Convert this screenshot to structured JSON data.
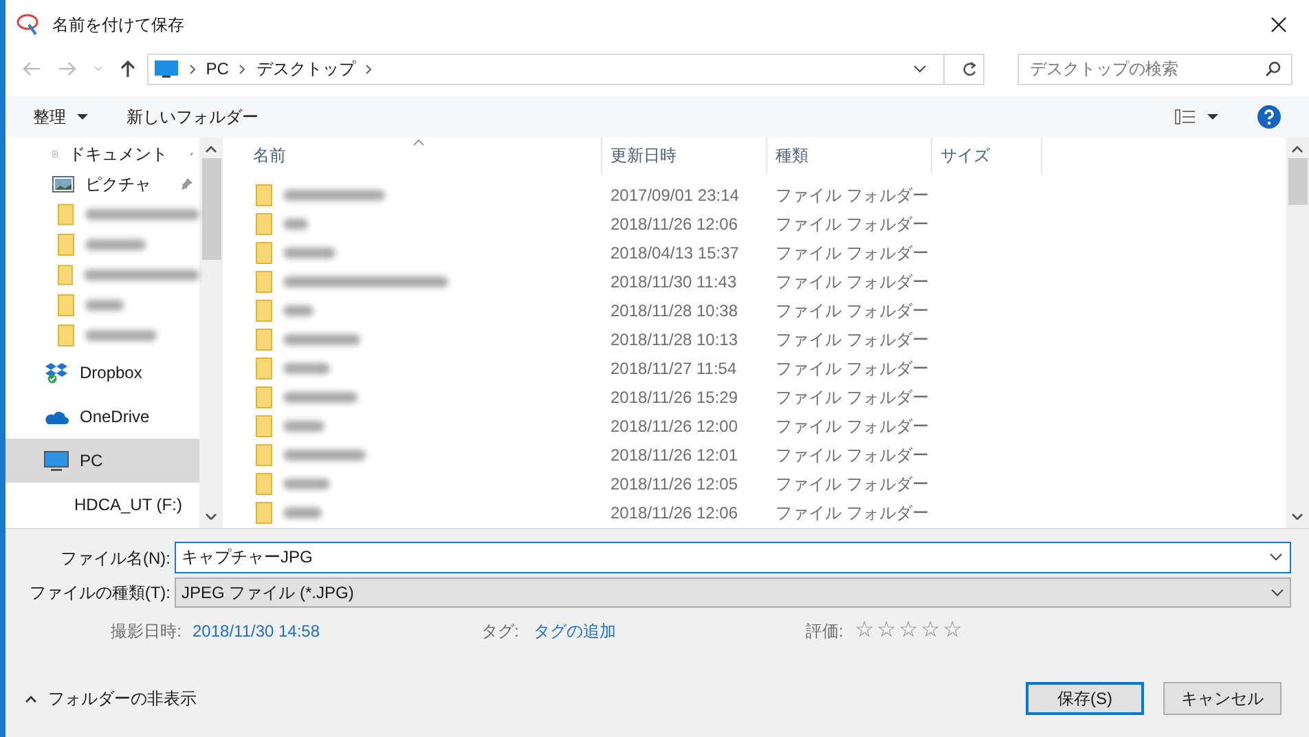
{
  "window": {
    "title": "名前を付けて保存"
  },
  "address": {
    "crumbs": [
      "PC",
      "デスクトップ"
    ]
  },
  "search": {
    "placeholder": "デスクトップの検索"
  },
  "toolbar": {
    "organize": "整理",
    "new_folder": "新しいフォルダー"
  },
  "sidebar": {
    "items": [
      {
        "kind": "document",
        "label": "ドキュメント",
        "pinned": true,
        "selected": false
      },
      {
        "kind": "picture",
        "label": "ピクチャ",
        "pinned": true,
        "selected": false
      },
      {
        "kind": "blurred-folder",
        "selected": false
      },
      {
        "kind": "blurred-folder",
        "selected": false
      },
      {
        "kind": "blurred-folder",
        "selected": false
      },
      {
        "kind": "blurred-folder",
        "selected": false
      },
      {
        "kind": "blurred-folder",
        "selected": false
      },
      {
        "kind": "dropbox",
        "label": "Dropbox",
        "selected": false
      },
      {
        "kind": "onedrive",
        "label": "OneDrive",
        "selected": false
      },
      {
        "kind": "pc",
        "label": "PC",
        "selected": true
      },
      {
        "kind": "drive",
        "label": "HDCA_UT (F:)",
        "selected": false
      }
    ]
  },
  "table": {
    "columns": [
      "名前",
      "更新日時",
      "種類",
      "サイズ"
    ],
    "rows": [
      {
        "modified": "2017/09/01 23:14",
        "type": "ファイル フォルダー"
      },
      {
        "modified": "2018/11/26 12:06",
        "type": "ファイル フォルダー"
      },
      {
        "modified": "2018/04/13 15:37",
        "type": "ファイル フォルダー"
      },
      {
        "modified": "2018/11/30 11:43",
        "type": "ファイル フォルダー"
      },
      {
        "modified": "2018/11/28 10:38",
        "type": "ファイル フォルダー"
      },
      {
        "modified": "2018/11/28 10:13",
        "type": "ファイル フォルダー"
      },
      {
        "modified": "2018/11/27 11:54",
        "type": "ファイル フォルダー"
      },
      {
        "modified": "2018/11/26 15:29",
        "type": "ファイル フォルダー"
      },
      {
        "modified": "2018/11/26 12:00",
        "type": "ファイル フォルダー"
      },
      {
        "modified": "2018/11/26 12:01",
        "type": "ファイル フォルダー"
      },
      {
        "modified": "2018/11/26 12:05",
        "type": "ファイル フォルダー"
      },
      {
        "modified": "2018/11/26 12:06",
        "type": "ファイル フォルダー"
      }
    ]
  },
  "form": {
    "filename_label": "ファイル名(N):",
    "filename": "キャプチャーJPG",
    "filetype_label": "ファイルの種類(T):",
    "filetype": "JPEG ファイル (*.JPG)",
    "date_label": "撮影日時:",
    "date": "2018/11/30 14:58",
    "tags_label": "タグ:",
    "tags": "タグの追加",
    "rating_label": "評価:",
    "stars": 0
  },
  "footer": {
    "hide_folders": "フォルダーの非表示",
    "save": "保存(S)",
    "cancel": "キャンセル"
  }
}
